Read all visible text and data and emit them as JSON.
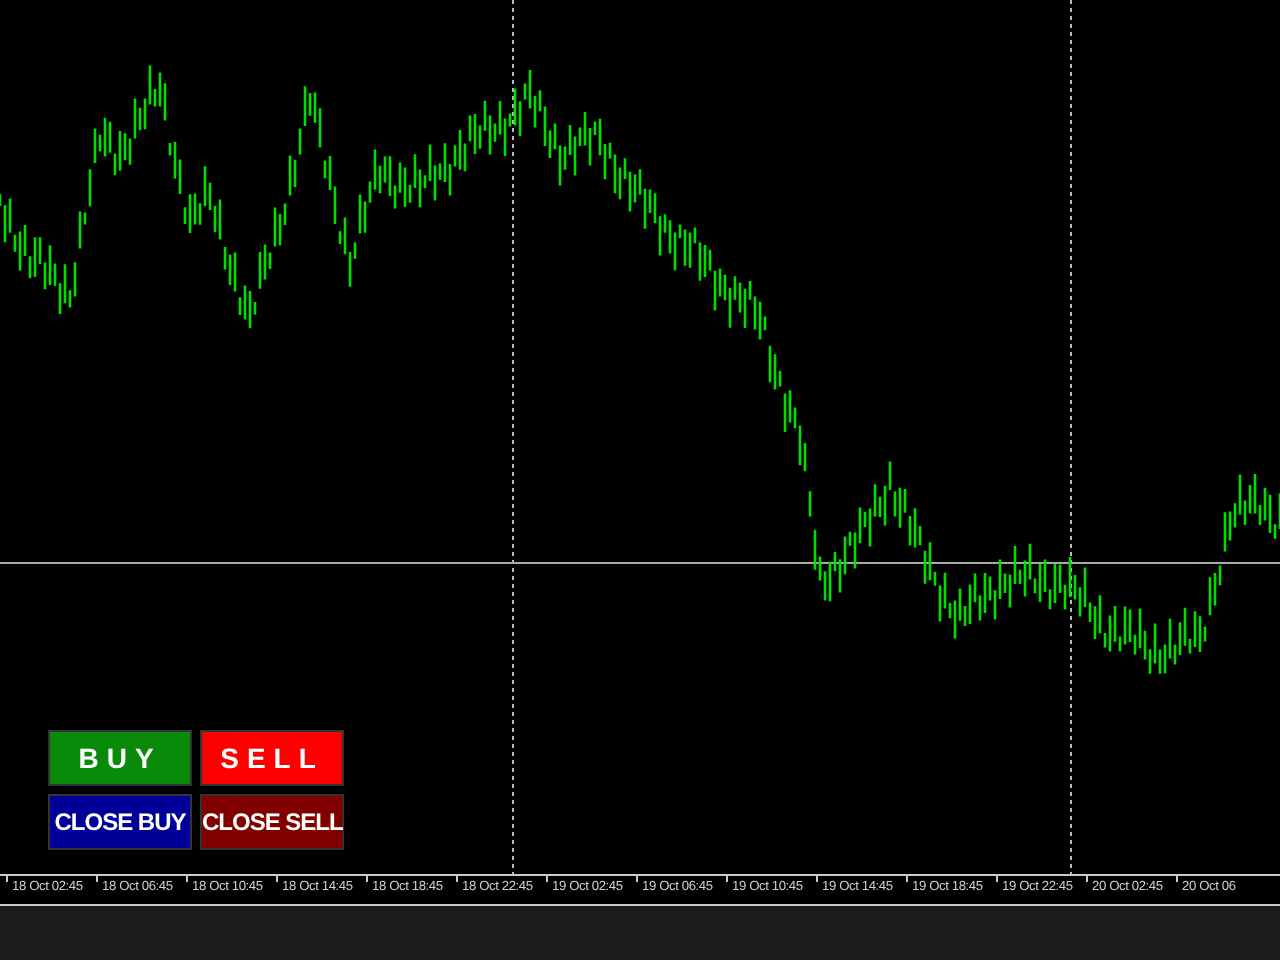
{
  "chart": {
    "kind": "candles"
  },
  "trade_buttons": [
    {
      "label": "BUY",
      "kind": "buy"
    },
    {
      "label": "SELL",
      "kind": "sell"
    },
    {
      "label": "CLOSE BUY",
      "kind": "close_buy"
    },
    {
      "label": "CLOSE SELL",
      "kind": "close_sell"
    }
  ],
  "time_axis": {
    "labels": [
      "18 Oct 02:45",
      "18 Oct 06:45",
      "18 Oct 10:45",
      "18 Oct 14:45",
      "18 Oct 18:45",
      "18 Oct 22:45",
      "19 Oct 02:45",
      "19 Oct 06:45",
      "19 Oct 10:45",
      "19 Oct 14:45",
      "19 Oct 18:45",
      "19 Oct 22:45",
      "20 Oct 02:45",
      "20 Oct 06"
    ]
  }
}
